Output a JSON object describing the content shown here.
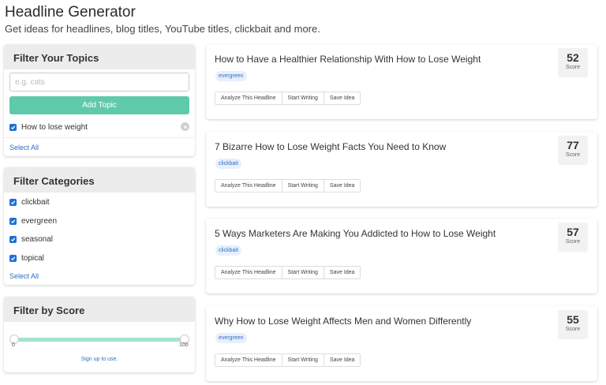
{
  "header": {
    "title": "Headline Generator",
    "subtitle": "Get ideas for headlines, blog titles, YouTube titles, clickbait and more."
  },
  "topics": {
    "title": "Filter Your Topics",
    "input_placeholder": "e.g. cats",
    "add_button": "Add Topic",
    "items": [
      {
        "label": "How to lose weight",
        "checked": true
      }
    ],
    "select_all": "Select All"
  },
  "categories": {
    "title": "Filter Categories",
    "items": [
      {
        "label": "clickbait",
        "checked": true
      },
      {
        "label": "evergreen",
        "checked": true
      },
      {
        "label": "seasonal",
        "checked": true
      },
      {
        "label": "topical",
        "checked": true
      }
    ],
    "select_all": "Select All"
  },
  "score_filter": {
    "title": "Filter by Score",
    "min_label": "0",
    "max_label": "100",
    "range_low": 0,
    "range_high": 100,
    "signup": "Sign up to use."
  },
  "headlines": [
    {
      "title": "How to Have a Healthier Relationship With How to Lose Weight",
      "tag": "evergreen",
      "score": "52"
    },
    {
      "title": "7 Bizarre How to Lose Weight Facts You Need to Know",
      "tag": "clickbait",
      "score": "77"
    },
    {
      "title": "5 Ways Marketers Are Making You Addicted to How to Lose Weight",
      "tag": "clickbait",
      "score": "57"
    },
    {
      "title": "Why How to Lose Weight Affects Men and Women Differently",
      "tag": "evergreen",
      "score": "55"
    }
  ],
  "headline_actions": {
    "analyze": "Analyze This Headline",
    "start": "Start Writing",
    "save": "Save Idea"
  },
  "score_label": "Score",
  "colors": {
    "accent": "#5fcaaa",
    "link": "#2f6dc8",
    "checkbox": "#1f6fd8"
  }
}
